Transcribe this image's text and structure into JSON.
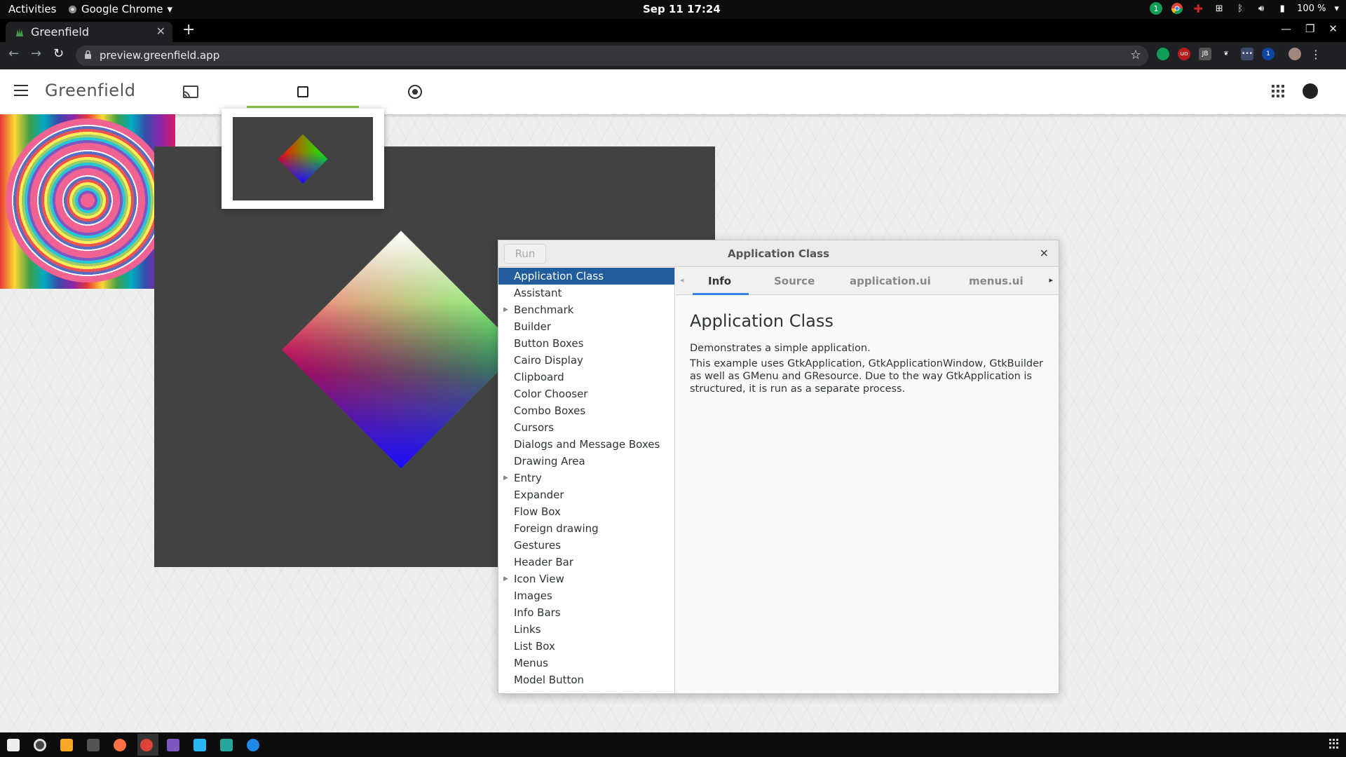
{
  "system_bar": {
    "activities": "Activities",
    "app_name": "Google Chrome",
    "clock": "Sep 11  17:24",
    "battery": "100 %",
    "notification_count": "1"
  },
  "browser": {
    "tab_title": "Greenfield",
    "url": "preview.greenfield.app"
  },
  "greenfield": {
    "brand": "Greenfield",
    "icons": [
      "cast-icon",
      "window-square-icon",
      "record-icon",
      "apps-grid-icon",
      "account-icon"
    ]
  },
  "gtk_demo": {
    "run_label": "Run",
    "window_title": "Application Class",
    "close_glyph": "×",
    "demos": [
      {
        "label": "Application Class",
        "selected": true,
        "expandable": false
      },
      {
        "label": "Assistant",
        "expandable": false
      },
      {
        "label": "Benchmark",
        "expandable": true
      },
      {
        "label": "Builder",
        "expandable": false
      },
      {
        "label": "Button Boxes",
        "expandable": false
      },
      {
        "label": "Cairo Display",
        "expandable": false
      },
      {
        "label": "Clipboard",
        "expandable": false
      },
      {
        "label": "Color Chooser",
        "expandable": false
      },
      {
        "label": "Combo Boxes",
        "expandable": false
      },
      {
        "label": "Cursors",
        "expandable": false
      },
      {
        "label": "Dialogs and Message Boxes",
        "expandable": false
      },
      {
        "label": "Drawing Area",
        "expandable": false
      },
      {
        "label": "Entry",
        "expandable": true
      },
      {
        "label": "Expander",
        "expandable": false
      },
      {
        "label": "Flow Box",
        "expandable": false
      },
      {
        "label": "Foreign drawing",
        "expandable": false
      },
      {
        "label": "Gestures",
        "expandable": false
      },
      {
        "label": "Header Bar",
        "expandable": false
      },
      {
        "label": "Icon View",
        "expandable": true
      },
      {
        "label": "Images",
        "expandable": false
      },
      {
        "label": "Info Bars",
        "expandable": false
      },
      {
        "label": "Links",
        "expandable": false
      },
      {
        "label": "List Box",
        "expandable": false
      },
      {
        "label": "Menus",
        "expandable": false
      },
      {
        "label": "Model Button",
        "expandable": false
      }
    ],
    "tabs": [
      {
        "label": "Info",
        "active": true
      },
      {
        "label": "Source"
      },
      {
        "label": "application.ui"
      },
      {
        "label": "menus.ui"
      }
    ],
    "info": {
      "heading": "Application Class",
      "para1": "Demonstrates a simple application.",
      "para2": "This example uses GtkApplication, GtkApplicationWindow, GtkBuilder as well as GMenu and GResource. Due to the way GtkApplication is structured, it is run as a separate process."
    }
  },
  "colors": {
    "accent_green": "#8bc34a",
    "selection_blue": "#215d9c",
    "tab_underline": "#3584e4",
    "surface_dark": "#424242"
  }
}
